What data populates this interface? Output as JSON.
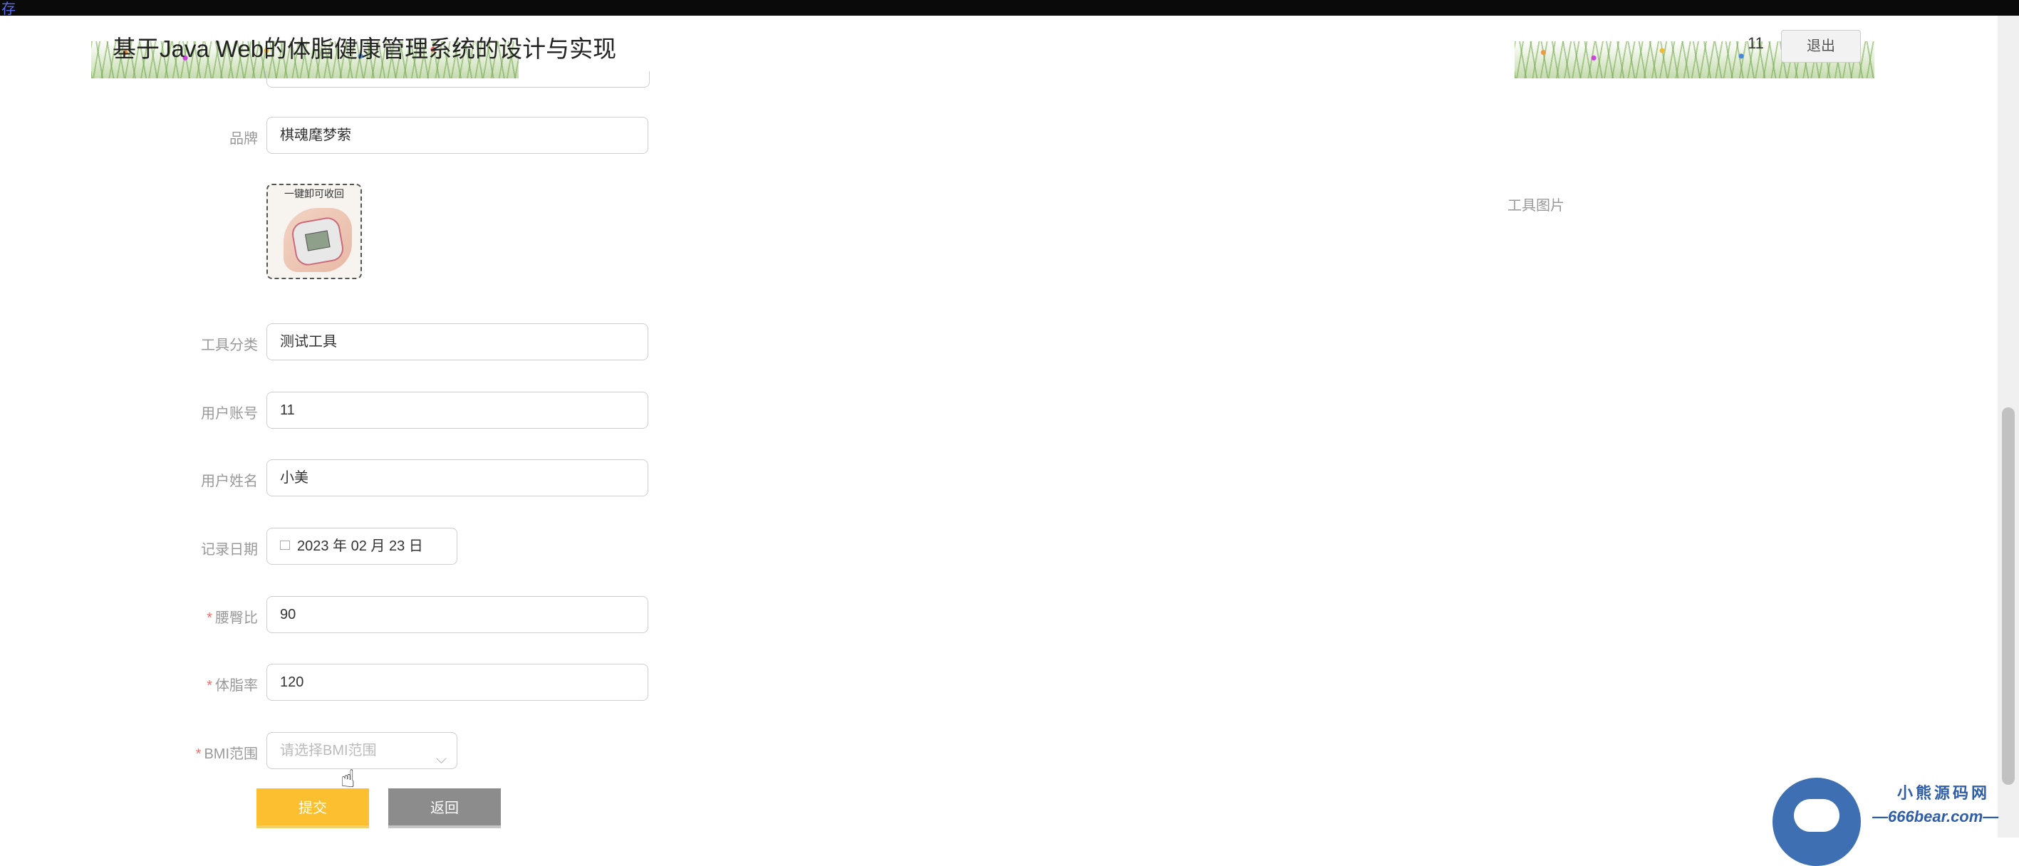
{
  "topbar": {
    "corner_text": "存"
  },
  "header": {
    "title": "基于Java Web的体脂健康管理系统的设计与实现",
    "user": "11",
    "logout_label": "退出"
  },
  "form": {
    "brand": {
      "label": "品牌",
      "value": "棋魂麾梦萦"
    },
    "tool_image": {
      "label": "工具图片",
      "caption": "一键卸可收回"
    },
    "tool_category": {
      "label": "工具分类",
      "value": "测试工具"
    },
    "user_account": {
      "label": "用户账号",
      "value": "11"
    },
    "user_name": {
      "label": "用户姓名",
      "value": "小美"
    },
    "record_date": {
      "label": "记录日期",
      "value": "2023 年 02 月 23 日"
    },
    "waist_hip_ratio": {
      "label": "腰臀比",
      "required_mark": "*",
      "value": "90"
    },
    "body_fat_rate": {
      "label": "体脂率",
      "required_mark": "*",
      "value": "120"
    },
    "bmi_range": {
      "label": "BMI范围",
      "required_mark": "*",
      "placeholder": "请选择BMI范围"
    }
  },
  "buttons": {
    "submit_label": "提交",
    "back_label": "返回"
  },
  "watermark": {
    "line1": "小熊源码网",
    "line2": "—666bear.com—"
  },
  "colors": {
    "submit": "#fbbf2f",
    "back": "#8c8c8c",
    "required": "#f56c6c",
    "watermark": "#2f5ea8"
  },
  "icons": {
    "calendar": "calendar-icon",
    "chevron": "chevron-down-icon",
    "cursor": "hand-pointer-icon"
  }
}
